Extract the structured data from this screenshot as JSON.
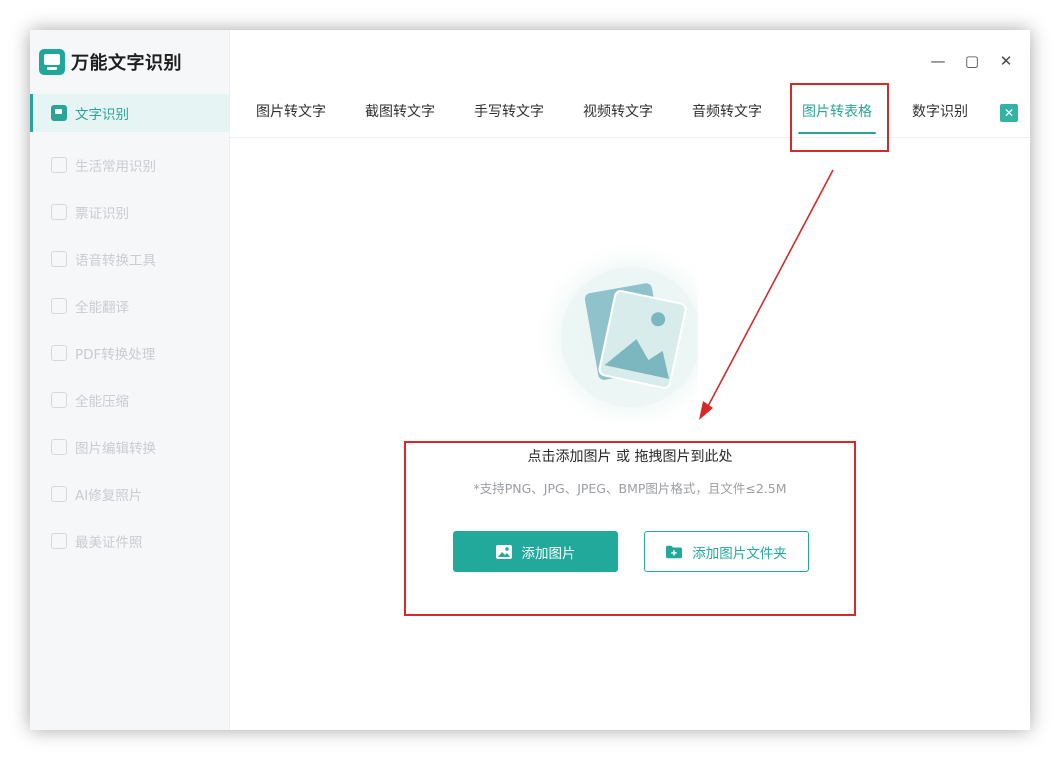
{
  "app": {
    "title": "万能文字识别",
    "brand_color": "#1fa89a"
  },
  "window_controls": {
    "minimize": "—",
    "maximize": "▢",
    "close": "✕"
  },
  "sidebar": {
    "items": [
      {
        "label": "文字识别",
        "icon": "scan-text-icon",
        "active": true
      },
      {
        "label": "生活常用识别",
        "icon": "scan-life-icon",
        "active": false
      },
      {
        "label": "票证识别",
        "icon": "ticket-icon",
        "active": false
      },
      {
        "label": "语音转换工具",
        "icon": "voice-icon",
        "active": false
      },
      {
        "label": "全能翻译",
        "icon": "translate-icon",
        "active": false
      },
      {
        "label": "PDF转换处理",
        "icon": "pdf-icon",
        "active": false
      },
      {
        "label": "全能压缩",
        "icon": "compress-icon",
        "active": false
      },
      {
        "label": "图片编辑转换",
        "icon": "image-edit-icon",
        "active": false
      },
      {
        "label": "AI修复照片",
        "icon": "ai-repair-icon",
        "active": false
      },
      {
        "label": "最美证件照",
        "icon": "id-photo-icon",
        "active": false
      }
    ]
  },
  "tabs": [
    {
      "label": "图片转文字",
      "active": false
    },
    {
      "label": "截图转文字",
      "active": false
    },
    {
      "label": "手写转文字",
      "active": false
    },
    {
      "label": "视频转文字",
      "active": false
    },
    {
      "label": "音频转文字",
      "active": false
    },
    {
      "label": "图片转表格",
      "active": true
    },
    {
      "label": "数字识别",
      "active": false
    }
  ],
  "upload": {
    "title": "点击添加图片 或 拖拽图片到此处",
    "subtitle": "*支持PNG、JPG、JPEG、BMP图片格式，且文件≤2.5M",
    "add_image_label": "添加图片",
    "add_folder_label": "添加图片文件夹"
  },
  "colors": {
    "accent": "#21aa9c",
    "annotation": "#d42a2a"
  }
}
